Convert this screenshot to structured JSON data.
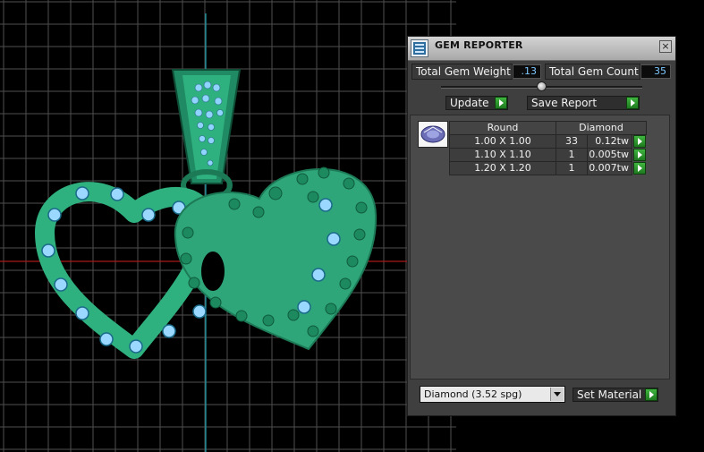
{
  "panel": {
    "title": "GEM REPORTER",
    "close_glyph": "×",
    "total_weight_label": "Total Gem Weight",
    "total_weight_value": ".13",
    "total_count_label": "Total Gem Count",
    "total_count_value": "35",
    "update_label": "Update",
    "save_report_label": "Save Report"
  },
  "report": {
    "shape_header": "Round",
    "material_header": "Diamond",
    "rows": [
      {
        "size": "1.00 X 1.00",
        "count": "33",
        "weight": "0.12tw"
      },
      {
        "size": "1.10 X 1.10",
        "count": "1",
        "weight": "0.005tw"
      },
      {
        "size": "1.20 X 1.20",
        "count": "1",
        "weight": "0.007tw"
      }
    ]
  },
  "material": {
    "selected": "Diamond     (3.52 spg)",
    "set_label": "Set Material"
  },
  "colors": {
    "model": "#2fa57a",
    "accent_go": "#2e9a2e",
    "grid": "#5a5a5a"
  }
}
